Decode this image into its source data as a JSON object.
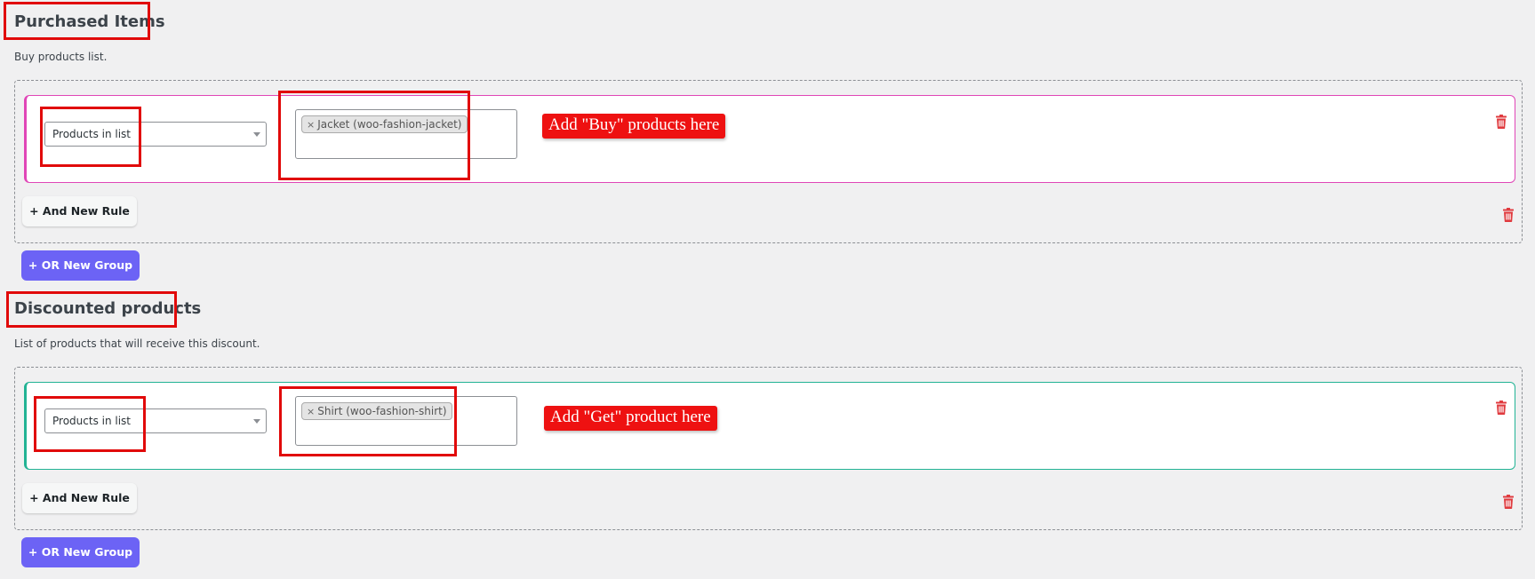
{
  "purchased": {
    "title": "Purchased Items",
    "description": "Buy products list.",
    "condition_select": "Products in list",
    "tag": "Jacket (woo-fashion-jacket)",
    "tag_remove": "×",
    "annotation": "Add \"Buy\" products here",
    "and_button": "+ And New Rule",
    "or_button": "+ OR New Group"
  },
  "discounted": {
    "title": "Discounted products",
    "description": "List of products that will receive this discount.",
    "condition_select": "Products in list",
    "tag": "Shirt (woo-fashion-shirt)",
    "tag_remove": "×",
    "annotation": "Add \"Get\" product here",
    "and_button": "+ And New Rule",
    "or_button": "+ OR New Group"
  },
  "colors": {
    "page_bg": "#f0f0f1",
    "buy_rule_border": "#e046b7",
    "get_rule_border": "#22b394",
    "or_button": "#6c63f5",
    "trash_icon": "#e03a3e",
    "annotation_bg": "#ee1111",
    "highlight_box": "#e10a0a"
  },
  "icons": [
    "trash-icon",
    "chevron-down-icon",
    "remove-tag-icon"
  ]
}
